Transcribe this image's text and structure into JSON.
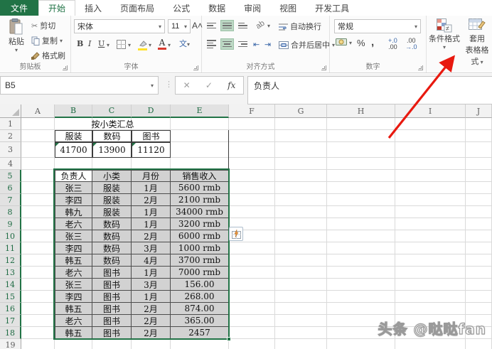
{
  "tabs": {
    "items": [
      {
        "label": "文件"
      },
      {
        "label": "开始"
      },
      {
        "label": "插入"
      },
      {
        "label": "页面布局"
      },
      {
        "label": "公式"
      },
      {
        "label": "数据"
      },
      {
        "label": "审阅"
      },
      {
        "label": "视图"
      },
      {
        "label": "开发工具"
      }
    ]
  },
  "ribbon": {
    "clipboard": {
      "paste": "粘贴",
      "cut": "剪切",
      "copy": "复制",
      "format_painter": "格式刷",
      "group": "剪贴板"
    },
    "font": {
      "family": "宋体",
      "size": "11",
      "bold": "B",
      "italic": "I",
      "underline": "U",
      "color_letter": "A",
      "phonetic": "文",
      "group": "字体"
    },
    "alignment": {
      "wrap": "自动换行",
      "merge": "合并后居中",
      "orientation": "ab",
      "group": "对齐方式"
    },
    "number": {
      "format": "常规",
      "percent": "%",
      "comma": ",",
      "inc_top": "+.0",
      "inc_bottom": ".00",
      "dec_top": ".00",
      "dec_bottom": "→.0",
      "group": "数字"
    },
    "styles": {
      "conditional": "条件格式",
      "format_table_line1": "套用",
      "format_table_line2": "表格格式"
    }
  },
  "formula_bar": {
    "name_box": "B5",
    "cancel": "✕",
    "enter": "✓",
    "fx": "fx",
    "formula": "负责人"
  },
  "sheet": {
    "columns": [
      "A",
      "B",
      "C",
      "D",
      "E",
      "F",
      "G",
      "H",
      "I",
      "J"
    ],
    "selected_columns": [
      "B",
      "C",
      "D",
      "E"
    ],
    "row_count": 19,
    "selected_row_start": 5,
    "selected_row_end": 18,
    "active_cell": "B5",
    "summary": {
      "title": "按小类汇总",
      "headers": [
        "服装",
        "数码",
        "图书"
      ],
      "values": [
        "41700",
        "13900",
        "11120"
      ]
    },
    "table": {
      "headers": [
        "负责人",
        "小类",
        "月份",
        "销售收入"
      ],
      "rows": [
        [
          "张三",
          "服装",
          "1月",
          "5600 rmb"
        ],
        [
          "李四",
          "服装",
          "2月",
          "2100 rmb"
        ],
        [
          "韩九",
          "服装",
          "1月",
          "34000 rmb"
        ],
        [
          "老六",
          "数码",
          "1月",
          "3200 rmb"
        ],
        [
          "张三",
          "数码",
          "2月",
          "6000 rmb"
        ],
        [
          "李四",
          "数码",
          "3月",
          "1000 rmb"
        ],
        [
          "韩五",
          "数码",
          "4月",
          "3700 rmb"
        ],
        [
          "老六",
          "图书",
          "1月",
          "7000 rmb"
        ],
        [
          "张三",
          "图书",
          "3月",
          "156.00"
        ],
        [
          "李四",
          "图书",
          "1月",
          "268.00"
        ],
        [
          "韩五",
          "图书",
          "2月",
          "874.00"
        ],
        [
          "老六",
          "图书",
          "2月",
          "365.00"
        ],
        [
          "韩五",
          "图书",
          "2月",
          "2457"
        ]
      ]
    }
  },
  "watermark": "头条 @哒哒fan",
  "colors": {
    "accent": "#217346",
    "arrow": "#e8190f",
    "selection_fill": "#d2d2d2"
  }
}
